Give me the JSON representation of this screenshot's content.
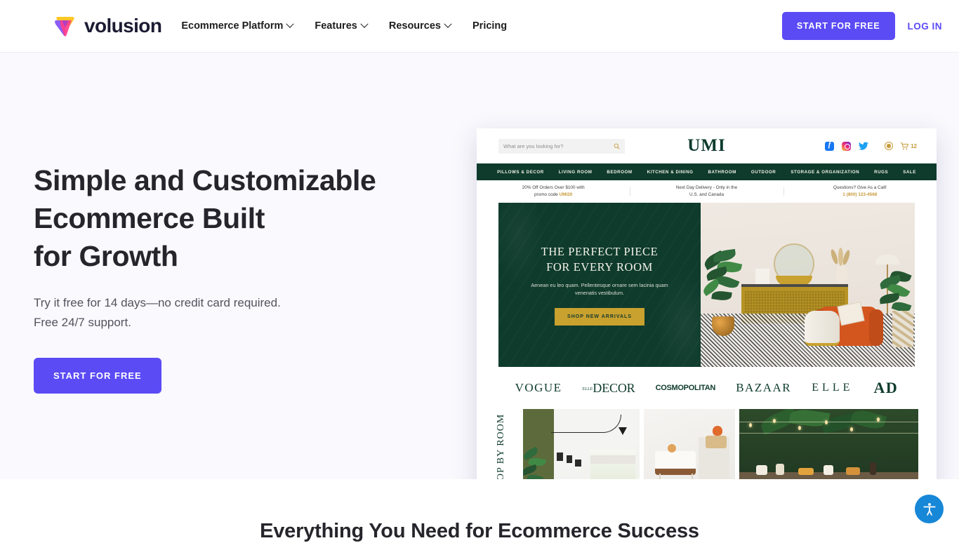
{
  "site": {
    "brand_name": "volusion",
    "logo_icon": "volusion-triangle-logo"
  },
  "topnav": {
    "items": [
      {
        "label": "Ecommerce Platform",
        "has_dropdown": true
      },
      {
        "label": "Features",
        "has_dropdown": true
      },
      {
        "label": "Resources",
        "has_dropdown": true
      },
      {
        "label": "Pricing",
        "has_dropdown": false
      }
    ],
    "cta_label": "START FOR FREE",
    "login_label": "LOG IN",
    "cta_color": "#5b4bf5"
  },
  "hero": {
    "heading_line1": "Simple and Customizable",
    "heading_line2": "Ecommerce Built",
    "heading_line3": "for Growth",
    "subtext": "Try it free for 14 days—no credit card required. Free 24/7 support.",
    "cta_label": "START FOR FREE",
    "background": "#faf9fe"
  },
  "mockup": {
    "search_placeholder": "What are you looking for?",
    "search_icon": "search-icon",
    "store_name": "UMI",
    "social": [
      "facebook-icon",
      "instagram-icon",
      "twitter-icon"
    ],
    "account_icon": "account-icon",
    "cart_icon": "cart-icon",
    "cart_count": "12",
    "nav_items": [
      "PILLOWS & DECOR",
      "LIVING ROOM",
      "BEDROOM",
      "KITCHEN & DINING",
      "BATHROOM",
      "OUTDOOR",
      "STORAGE & ORGANIZATION",
      "RUGS",
      "SALE"
    ],
    "promos": [
      {
        "line1": "20% Off Orders Over $100 with",
        "line2": "promo code ",
        "accent": "UMI20"
      },
      {
        "line1": "Next Day Delivery - Only in the",
        "line2": "U.S. and Canada",
        "accent": ""
      },
      {
        "line1": "Questions? Give As a Call!",
        "line2": "",
        "accent": "1 (800) 123-4568"
      }
    ],
    "banner": {
      "title_line1": "THE PERFECT PIECE",
      "title_line2": "FOR EVERY ROOM",
      "body": "Aenean eu leo quam. Pellentesque ornare sem lacinia quam venenatis vestibulum.",
      "button_label": "SHOP NEW ARRIVALS",
      "bg_color": "#0e3b2c",
      "button_color": "#c9a12e"
    },
    "press_logos": [
      "VOGUE",
      "DECOR",
      "COSMOPOLITAN",
      "BAZAAR",
      "ELLE",
      "AD"
    ],
    "press_logo_decor_prefix": "ELLE",
    "shop_by_room_label": "SHOP BY ROOM",
    "room_tiles": [
      "green-wall-living-room-photo",
      "nursery-crib-photo",
      "outdoor-garden-party-photo"
    ]
  },
  "section2": {
    "title": "Everything You Need for Ecommerce Success"
  },
  "accessibility": {
    "icon": "accessibility-person-icon",
    "color": "#1787d8"
  }
}
